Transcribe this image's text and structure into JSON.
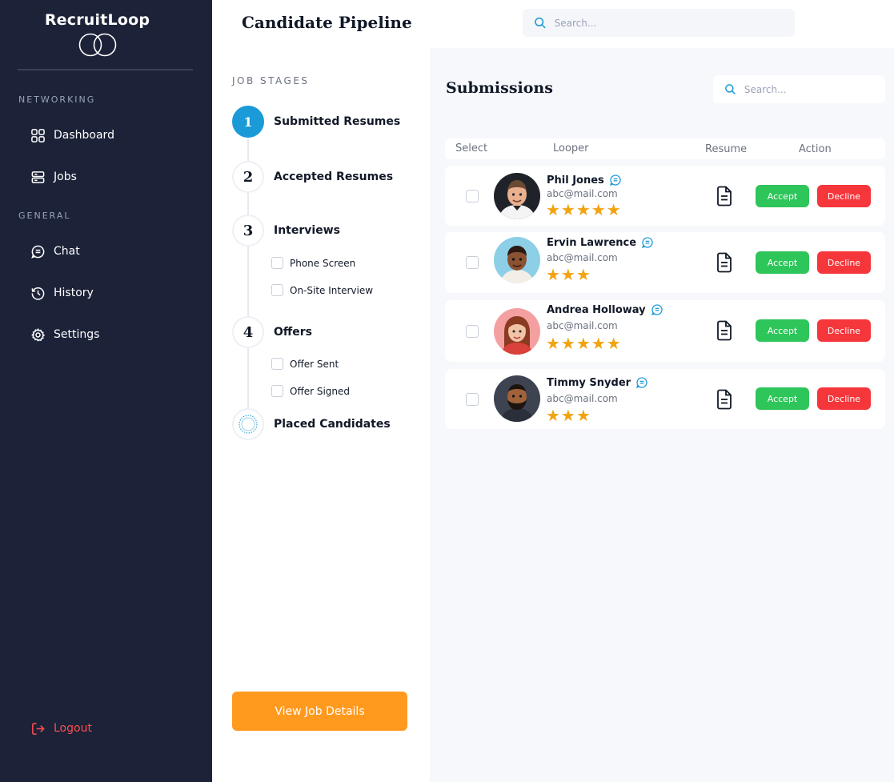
{
  "brand": {
    "name": "RecruitLoop"
  },
  "sidebar": {
    "section_networking": "NETWORKING",
    "section_general": "GENERAL",
    "items": [
      {
        "label": "Dashboard",
        "icon": "grid-icon"
      },
      {
        "label": "Jobs",
        "icon": "briefcase-icon"
      },
      {
        "label": "Chat",
        "icon": "chat-icon"
      },
      {
        "label": "History",
        "icon": "history-icon"
      },
      {
        "label": "Settings",
        "icon": "gear-icon"
      }
    ],
    "logout": "Logout"
  },
  "header": {
    "title": "Candidate Pipeline",
    "search_placeholder": "Search..."
  },
  "stages": {
    "heading": "JOB STAGES",
    "list": [
      {
        "number": "1",
        "label": "Submitted Resumes",
        "active": true
      },
      {
        "number": "2",
        "label": "Accepted Resumes"
      },
      {
        "number": "3",
        "label": "Interviews",
        "substeps": [
          "Phone Screen",
          "On-Site Interview"
        ]
      },
      {
        "number": "4",
        "label": "Offers",
        "substeps": [
          "Offer Sent",
          "Offer Signed"
        ]
      },
      {
        "number": "",
        "label": "Placed Candidates"
      }
    ],
    "view_button": "View Job Details"
  },
  "submissions": {
    "title": "Submissions",
    "search_placeholder": "Search...",
    "columns": [
      "Select",
      "Looper",
      "Resume",
      "Action"
    ],
    "accept_label": "Accept",
    "decline_label": "Decline",
    "rows": [
      {
        "name": "Phil Jones",
        "email": "abc@mail.com",
        "rating": 5,
        "stars": "★★★★★"
      },
      {
        "name": "Ervin Lawrence",
        "email": "abc@mail.com",
        "rating": 3,
        "stars": "★★★"
      },
      {
        "name": "Andrea Holloway",
        "email": "abc@mail.com",
        "rating": 5,
        "stars": "★★★★★"
      },
      {
        "name": "Timmy Snyder",
        "email": "abc@mail.com",
        "rating": 3,
        "stars": "★★★"
      }
    ]
  },
  "colors": {
    "sidebar_bg": "#1c2238",
    "accent_blue": "#1a9ad6",
    "accept_green": "#2ec55a",
    "decline_red": "#f5363a",
    "cta_orange": "#ff9a1f",
    "star_gold": "#f2a30f"
  }
}
